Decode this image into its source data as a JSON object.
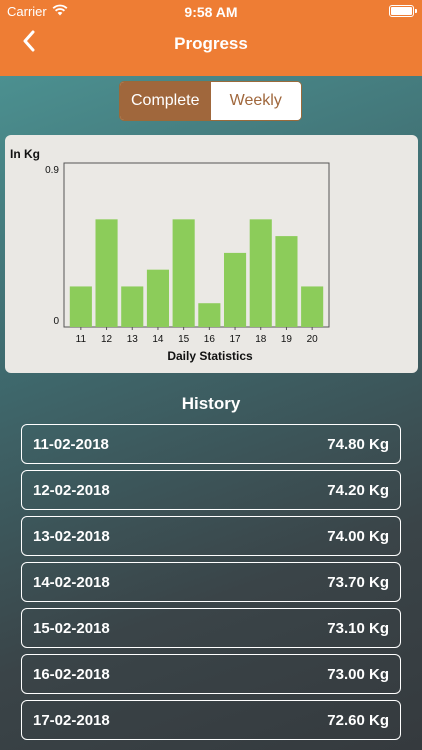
{
  "status_bar": {
    "carrier": "Carrier",
    "time": "9:58 AM"
  },
  "nav": {
    "title": "Progress",
    "back_icon": "chevron-left-icon"
  },
  "segment": {
    "complete": "Complete",
    "weekly": "Weekly",
    "selected": "Complete"
  },
  "colors": {
    "header": "#ee7d34",
    "accent": "#a0673c",
    "bar": "#8ccc5a"
  },
  "chart_data": {
    "type": "bar",
    "ylabel": "In Kg",
    "xlabel": "Daily Statistics",
    "ylim": [
      0,
      0.9
    ],
    "yticks": [
      "0",
      "0.9"
    ],
    "categories": [
      "11",
      "12",
      "13",
      "14",
      "15",
      "16",
      "17",
      "18",
      "19",
      "20"
    ],
    "values": [
      0.2,
      0.6,
      0.2,
      0.3,
      0.6,
      0.1,
      0.4,
      0.6,
      0.5,
      0.2
    ],
    "grid": false,
    "legend": false
  },
  "history": {
    "title": "History",
    "rows": [
      {
        "date": "11-02-2018",
        "weight": "74.80 Kg"
      },
      {
        "date": "12-02-2018",
        "weight": "74.20 Kg"
      },
      {
        "date": "13-02-2018",
        "weight": "74.00 Kg"
      },
      {
        "date": "14-02-2018",
        "weight": "73.70 Kg"
      },
      {
        "date": "15-02-2018",
        "weight": "73.10 Kg"
      },
      {
        "date": "16-02-2018",
        "weight": "73.00 Kg"
      },
      {
        "date": "17-02-2018",
        "weight": "72.60 Kg"
      }
    ]
  }
}
